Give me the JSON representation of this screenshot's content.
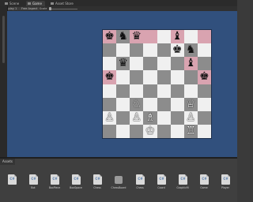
{
  "tabs": [
    {
      "label": "Scene",
      "active": false
    },
    {
      "label": "Game",
      "active": true
    },
    {
      "label": "Asset Store",
      "active": false
    }
  ],
  "toolbar": {
    "display": "Display 1",
    "aspect": "Free Aspect",
    "scale_label": "Scale"
  },
  "board": {
    "light_color": "#f0f0f0",
    "dark_color": "#8c8c8c",
    "highlight_color": "#d9a3b0",
    "highlighted_squares": [
      "a8",
      "c8",
      "d8",
      "f8",
      "h8",
      "g6",
      "a5",
      "h5"
    ],
    "rows": [
      [
        "bK",
        "bN",
        "bQ",
        "",
        "",
        "bB",
        "",
        ""
      ],
      [
        "",
        "",
        "",
        "",
        "",
        "bK",
        "bN",
        ""
      ],
      [
        "",
        "bQ",
        "",
        "",
        "",
        "",
        "bB",
        ""
      ],
      [
        "bK",
        "",
        "",
        "",
        "",
        "",
        "",
        "bK"
      ],
      [
        "",
        "",
        "",
        "",
        "",
        "",
        "",
        ""
      ],
      [
        "",
        "",
        "wN",
        "",
        "",
        "",
        "wQ",
        ""
      ],
      [
        "wP",
        "",
        "wP",
        "wB",
        "",
        "",
        "wP",
        ""
      ],
      [
        "",
        "",
        "",
        "wK",
        "",
        "",
        "wR",
        ""
      ]
    ]
  },
  "pieces": {
    "wK": "♔",
    "wQ": "♕",
    "wR": "♖",
    "wB": "♗",
    "wN": "♘",
    "wP": "♙",
    "bK": "♚",
    "bQ": "♛",
    "bR": "♜",
    "bB": "♝",
    "bN": "♞",
    "bP": "♟"
  },
  "project": {
    "title": "Assets",
    "assets": [
      {
        "name": "",
        "icon": "csharp-file-icon"
      },
      {
        "name": "Bot",
        "icon": "csharp-file-icon"
      },
      {
        "name": "BoxPiece",
        "icon": "csharp-file-icon"
      },
      {
        "name": "BoxSpace",
        "icon": "csharp-file-icon"
      },
      {
        "name": "Chess",
        "icon": "csharp-file-icon"
      },
      {
        "name": "ChessBoard",
        "icon": "prefab-icon"
      },
      {
        "name": "Chess",
        "icon": "csharp-file-icon"
      },
      {
        "name": "Coord",
        "icon": "csharp-file-icon"
      },
      {
        "name": "GraphicM",
        "icon": "csharp-file-icon"
      },
      {
        "name": "Game",
        "icon": "csharp-file-icon"
      },
      {
        "name": "Player",
        "icon": "csharp-file-icon"
      }
    ]
  }
}
